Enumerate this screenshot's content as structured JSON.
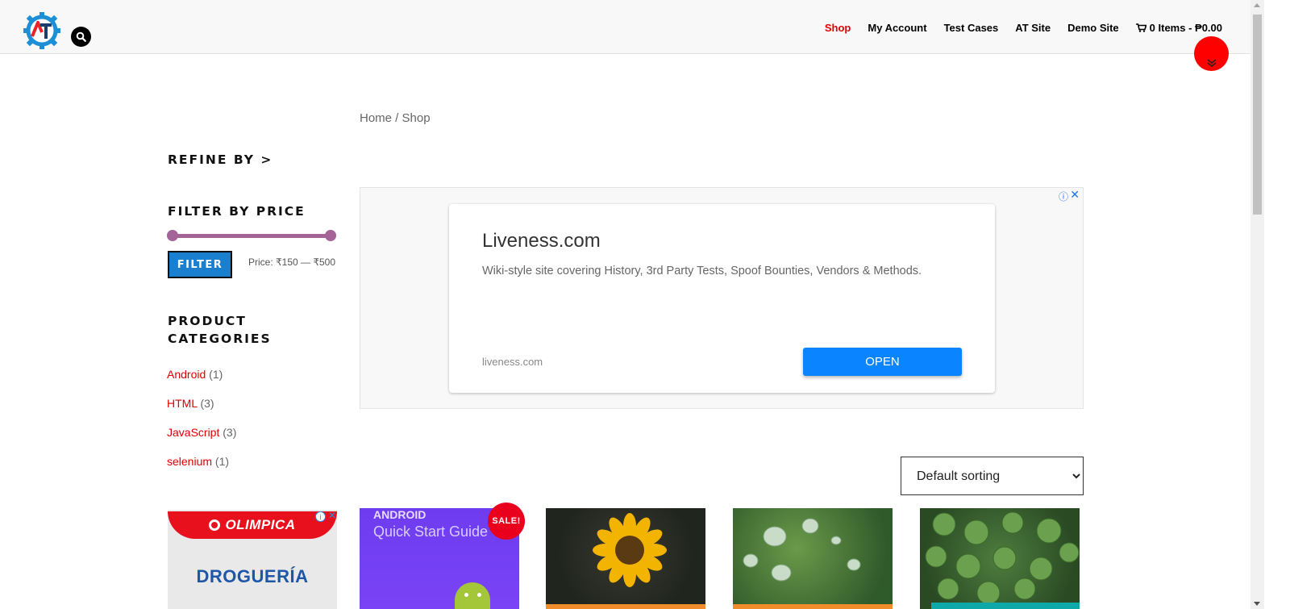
{
  "nav": {
    "items": [
      "Shop",
      "My Account",
      "Test Cases",
      "AT Site",
      "Demo Site"
    ],
    "cart": "0 Items - ₱0.00"
  },
  "breadcrumb": "Home / Shop",
  "sidebar": {
    "refine": "REFINE BY >",
    "filter_heading": "FILTER BY PRICE",
    "filter_button": "FILTER",
    "price_range": "Price: ₹150 — ₹500",
    "categories_heading_line1": "PRODUCT",
    "categories_heading_line2": "CATEGORIES",
    "categories": [
      {
        "name": "Android",
        "count": "(1)"
      },
      {
        "name": "HTML",
        "count": "(3)"
      },
      {
        "name": "JavaScript",
        "count": "(3)"
      },
      {
        "name": "selenium",
        "count": "(1)"
      }
    ],
    "side_ad": {
      "brand": "OLIMPICA",
      "text": "DROGUERÍA"
    }
  },
  "ad": {
    "title": "Liveness.com",
    "description": "Wiki-style site covering History, 3rd Party Tests, Spoof Bounties, Vendors & Methods.",
    "domain": "liveness.com",
    "button": "OPEN"
  },
  "sorting": {
    "selected": "Default sorting"
  },
  "products": [
    {
      "line1": "ANDROID",
      "line2": "Quick Start Guide",
      "badge": "SALE!"
    }
  ],
  "colors": {
    "accent": "#e00000",
    "filter_button": "#1b7fd0",
    "slider": "#a46497",
    "open_button": "#0a84ff"
  }
}
